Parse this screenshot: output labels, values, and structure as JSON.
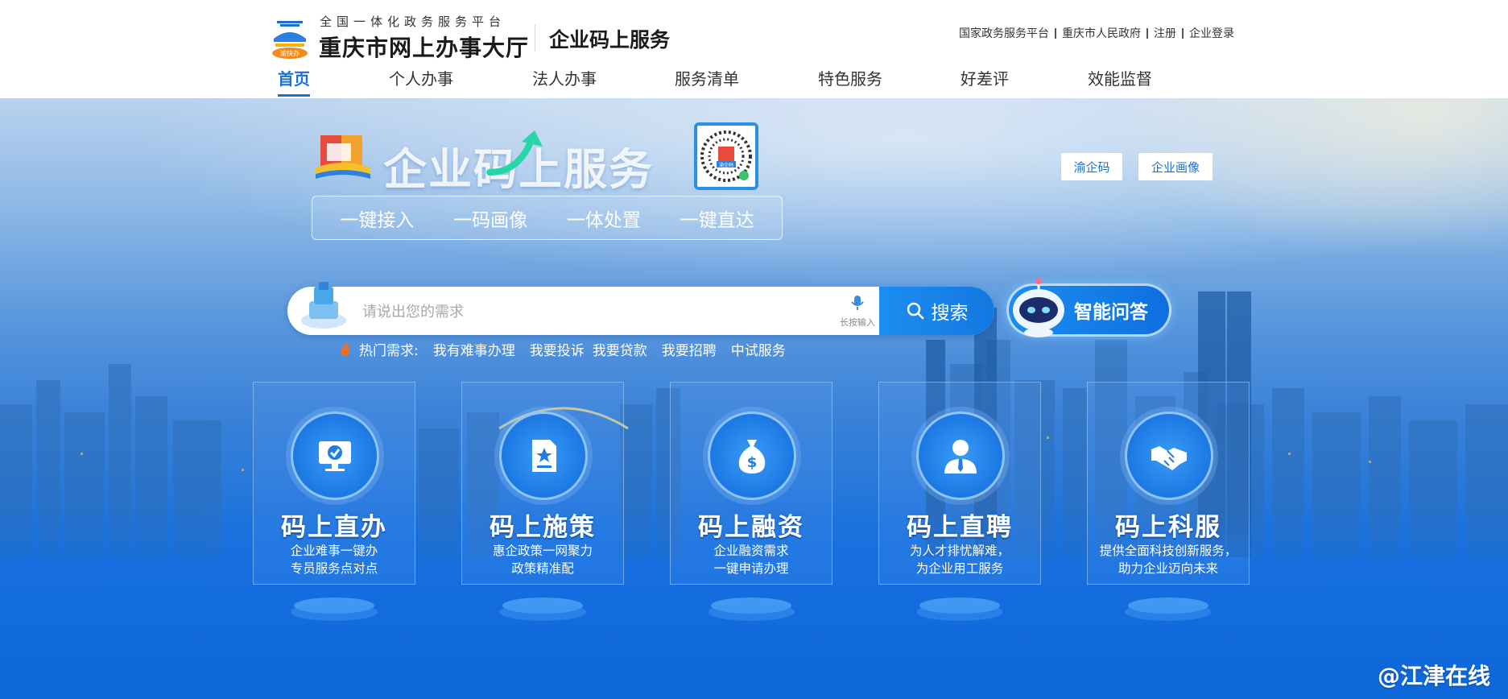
{
  "header": {
    "logo_badge_text": "渝快办",
    "logo_subtitle": "全国一体化政务服务平台",
    "logo_title": "重庆市网上办事大厅",
    "service_title": "企业码上服务",
    "top_links": [
      "国家政务服务平台",
      "重庆市人民政府",
      "注册",
      "企业登录"
    ]
  },
  "nav": {
    "items": [
      "首页",
      "个人办事",
      "法人办事",
      "服务清单",
      "特色服务",
      "好差评",
      "效能监督"
    ],
    "active": "首页"
  },
  "hero": {
    "brand_title": "企业码上服务",
    "qr_label": "渝企码",
    "features": [
      "一键接入",
      "一码画像",
      "一体处置",
      "一键直达"
    ],
    "buttons": [
      "渝企码",
      "企业画像"
    ]
  },
  "search": {
    "placeholder": "请说出您的需求",
    "voice_label": "长按输入",
    "button_label": "搜索",
    "ai_label": "智能问答"
  },
  "hot": {
    "label": "热门需求:",
    "items": [
      "我有难事办理",
      "我要投诉",
      "我要贷款",
      "我要招聘",
      "中试服务"
    ]
  },
  "cards": [
    {
      "title": "码上直办",
      "desc1": "企业难事一键办",
      "desc2": "专员服务点对点",
      "icon": "monitor-check-icon"
    },
    {
      "title": "码上施策",
      "desc1": "惠企政策一网聚力",
      "desc2": "政策精准配",
      "icon": "document-star-icon"
    },
    {
      "title": "码上融资",
      "desc1": "企业融资需求",
      "desc2": "一键申请办理",
      "icon": "money-bag-icon"
    },
    {
      "title": "码上直聘",
      "desc1": "为人才排忧解难，",
      "desc2": "为企业用工服务",
      "icon": "person-icon"
    },
    {
      "title": "码上科服",
      "desc1": "提供全面科技创新服务，",
      "desc2": "助力企业迈向未来",
      "icon": "handshake-icon"
    }
  ],
  "watermark": "@江津在线",
  "colors": {
    "accent": "#1f6fd1",
    "search_button": "#1b8df0",
    "hero_top": "#b9d2ee",
    "hero_bottom": "#1169db"
  }
}
